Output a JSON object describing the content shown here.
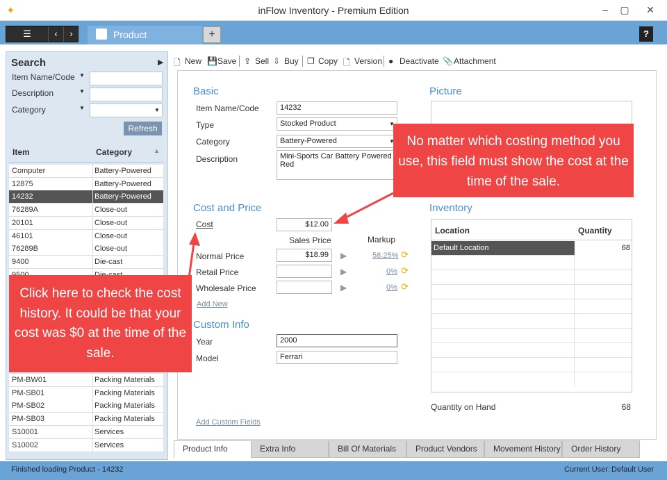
{
  "window": {
    "title": "inFlow Inventory - Premium Edition"
  },
  "tabs": {
    "active": "Product"
  },
  "search": {
    "title": "Search",
    "fields": [
      {
        "label": "Item Name/Code",
        "value": ""
      },
      {
        "label": "Description",
        "value": ""
      },
      {
        "label": "Category",
        "value": ""
      }
    ],
    "refresh_label": "Refresh"
  },
  "product_list": {
    "headers": [
      "Item",
      "Category"
    ],
    "rows": [
      {
        "item": "Computer",
        "category": "Battery-Powered",
        "selected": false
      },
      {
        "item": "12875",
        "category": "Battery-Powered",
        "selected": false
      },
      {
        "item": "14232",
        "category": "Battery-Powered",
        "selected": true
      },
      {
        "item": "76289A",
        "category": "Close-out",
        "selected": false
      },
      {
        "item": "20101",
        "category": "Close-out",
        "selected": false
      },
      {
        "item": "46101",
        "category": "Close-out",
        "selected": false
      },
      {
        "item": "76289B",
        "category": "Close-out",
        "selected": false
      },
      {
        "item": "9400",
        "category": "Die-cast",
        "selected": false
      },
      {
        "item": "9500",
        "category": "Die-cast",
        "selected": false
      },
      {
        "item": "PM-BW01",
        "category": "Packing Materials",
        "selected": false
      },
      {
        "item": "PM-SB01",
        "category": "Packing Materials",
        "selected": false
      },
      {
        "item": "PM-SB02",
        "category": "Packing Materials",
        "selected": false
      },
      {
        "item": "PM-SB03",
        "category": "Packing Materials",
        "selected": false
      },
      {
        "item": "S10001",
        "category": "Services",
        "selected": false
      },
      {
        "item": "S10002",
        "category": "Services",
        "selected": false
      }
    ]
  },
  "toolbar": {
    "new": "New",
    "save": "Save",
    "sell": "Sell",
    "buy": "Buy",
    "copy": "Copy",
    "version": "Version",
    "deactivate": "Deactivate",
    "attachment": "Attachment"
  },
  "basic": {
    "title": "Basic",
    "item_code_label": "Item Name/Code",
    "item_code": "14232",
    "type_label": "Type",
    "type": "Stocked Product",
    "category_label": "Category",
    "category": "Battery-Powered",
    "description_label": "Description",
    "description": "Mini-Sports Car Battery Powered Red"
  },
  "cost_price": {
    "title": "Cost and Price",
    "cost_label": "Cost",
    "cost": "$12.00",
    "sales_price_header": "Sales Price",
    "markup_header": "Markup",
    "normal_label": "Normal Price",
    "normal_price": "$18.99",
    "normal_markup": "58.25%",
    "retail_label": "Retail Price",
    "retail_price": "",
    "retail_markup": "0%",
    "wholesale_label": "Wholesale Price",
    "wholesale_price": "",
    "wholesale_markup": "0%",
    "add_new": "Add New"
  },
  "custom_info": {
    "title": "Custom Info",
    "year_label": "Year",
    "year": "2000",
    "model_label": "Model",
    "model": "Ferrari",
    "add_fields": "Add Custom Fields"
  },
  "picture": {
    "title": "Picture"
  },
  "inventory": {
    "title": "Inventory",
    "headers": [
      "Location",
      "Quantity"
    ],
    "rows": [
      {
        "location": "Default Location",
        "quantity": "68"
      }
    ],
    "qoh_label": "Quantity on Hand",
    "qoh": "68"
  },
  "bottom_tabs": [
    "Product Info",
    "Extra Info",
    "Bill Of Materials",
    "Product Vendors",
    "Movement History",
    "Order History"
  ],
  "status": {
    "message": "Finished loading Product - 14232",
    "user_label": "Current User:",
    "user": "Default User"
  },
  "callouts": {
    "cost_field": "No matter which costing method you use, this field must show the cost at the time of the sale.",
    "cost_history": "Click here to check the cost history. It could be that your cost was $0 at the time of the sale."
  },
  "colors": {
    "accent": "#6aa3d6",
    "callout": "#f04545",
    "section": "#4a8ed0"
  }
}
